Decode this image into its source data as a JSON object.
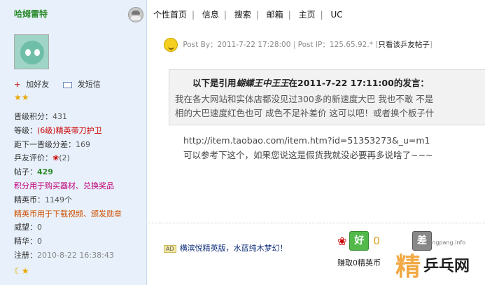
{
  "user": {
    "name": "哈姆雷特",
    "add_friend": "加好友",
    "send_message": "发短信",
    "stars": "★★",
    "level_points_label": "晋级积分：",
    "level_points": "431",
    "rank_label": "等级：",
    "rank": "(6级)精英带刀护卫",
    "next_level_label": "距下一晋级分差：",
    "next_level": "169",
    "rating_label": "乒友评价：",
    "rating": "(2)",
    "posts_label": "帖子：",
    "posts": "429",
    "points_note": "积分用于购买器材、兑换奖品",
    "elite_coins_label": "精英币：",
    "elite_coins": "1149个",
    "elite_note": "精英币用于下载视频、颁发勋章",
    "prestige_label": "威望：",
    "prestige": "0",
    "essence_label": "精华：",
    "essence": "0",
    "registered_label": "注册：",
    "registered": "2010-8-22 16:38:43"
  },
  "nav": [
    "个性首页",
    "信息",
    "搜索",
    "邮箱",
    "主页",
    "UC"
  ],
  "post": {
    "post_by_label": "Post By：",
    "post_by": "2011-7-22 17:28:00",
    "post_ip_label": "Post IP：",
    "post_ip": "125.65.92.*",
    "only_author": "只看该乒友帖子",
    "quote_prefix": "以下是引用",
    "quote_author": "蝴蝶王中王王",
    "quote_suffix": "在2011-7-22 17:11:00的发言：",
    "quote_line1": "我在各大网站和实体店都没见过300多的新速度大巴  我也不敢  不是",
    "quote_line2": "相的大巴速度红色也可  成色不足补差价  这可以吧！或者换个板子什",
    "body_line1": "http://item.taobao.com/item.htm?id=51353273&_u=m1",
    "body_line2": "可以参考下这个，如果您说这是假货我就没必要再多说啥了~~~"
  },
  "footer": {
    "ad_badge": "AD",
    "signature": "横滨悦精英版，水蓝纯木梦幻！",
    "good_label": "好",
    "good_count": "0",
    "bad_label": "差",
    "earn_text": "赚取0精英币",
    "watermark_char": "精",
    "watermark_text": "乒乓网",
    "watermark_url": "pingpang.info"
  }
}
